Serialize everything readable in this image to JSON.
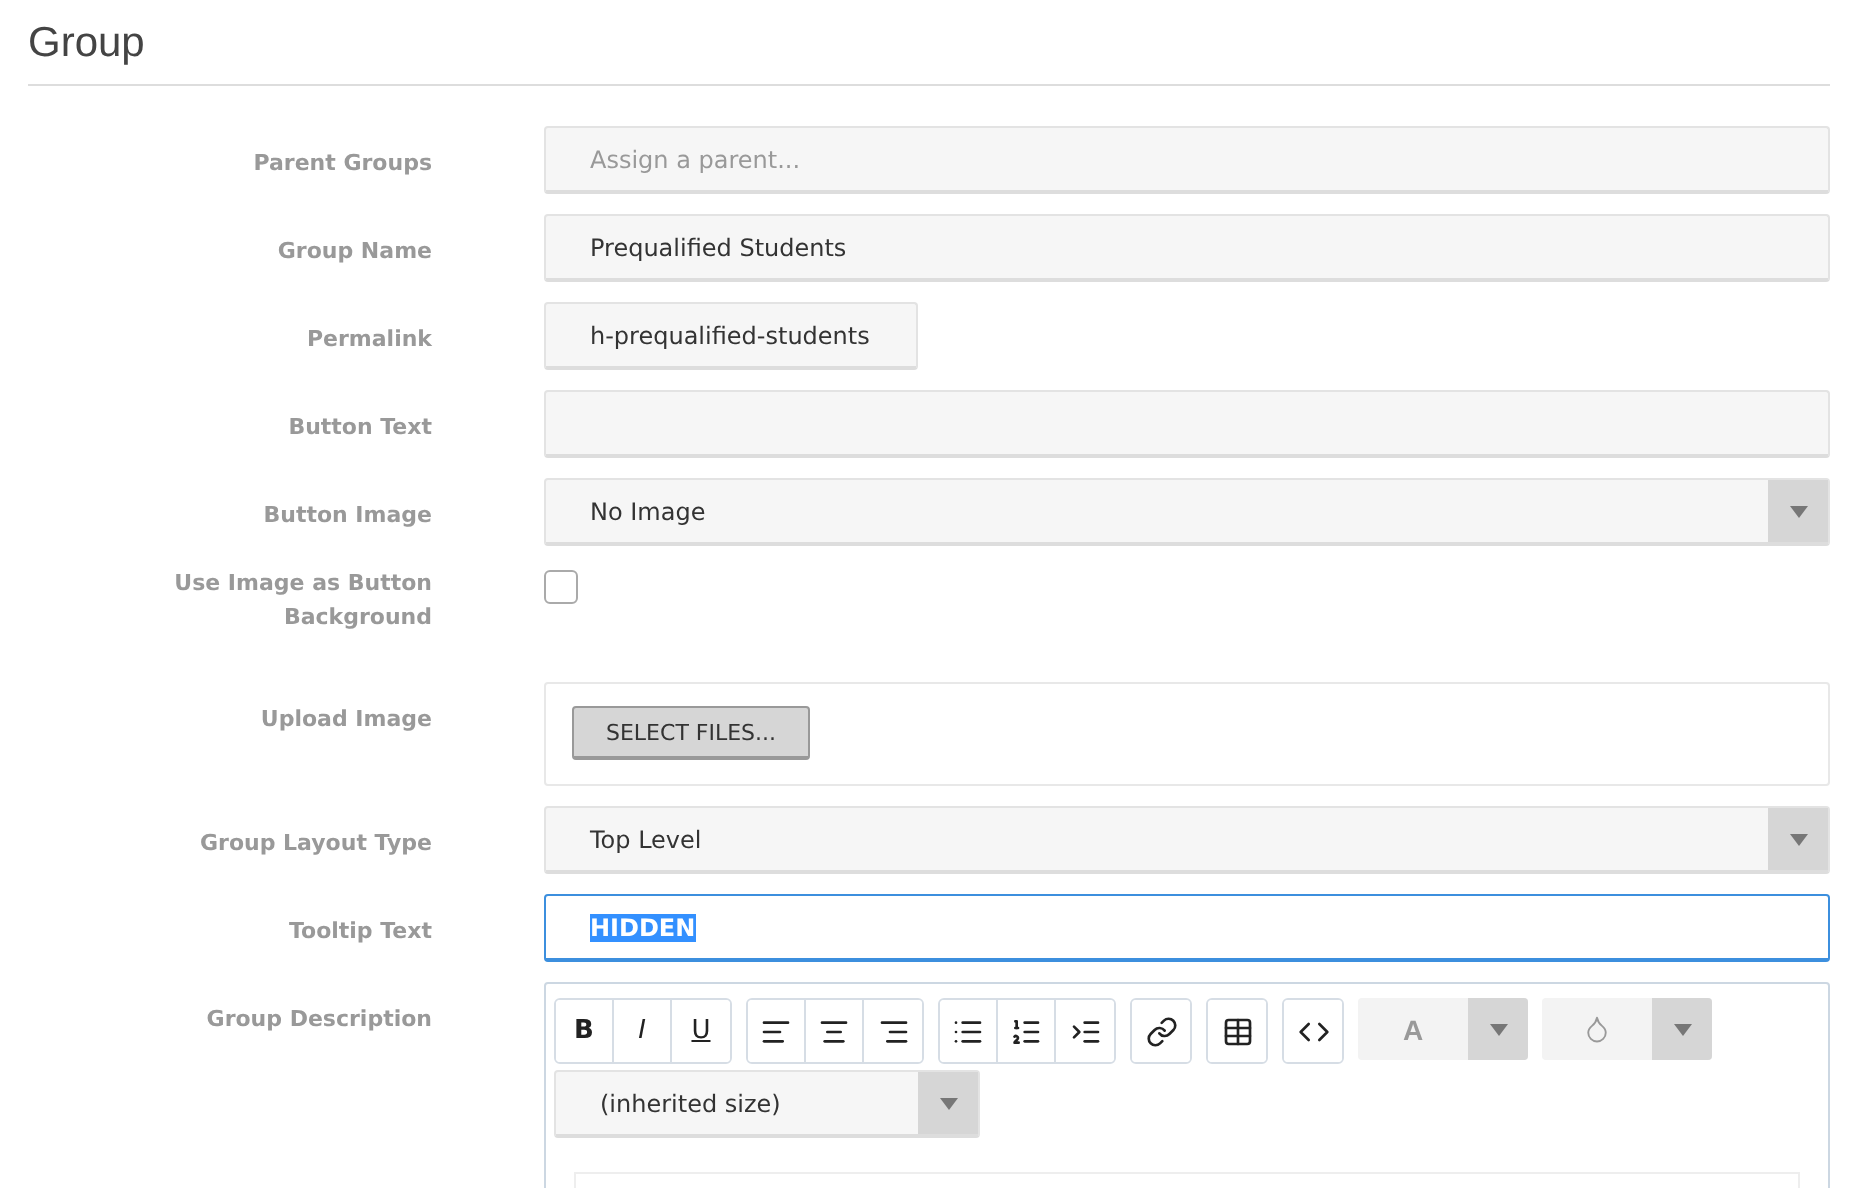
{
  "title": "Group",
  "fields": [
    {
      "kind": "text",
      "label": "Parent Groups",
      "placeholder": "Assign a parent..."
    },
    {
      "kind": "text",
      "label": "Group Name",
      "value": "Prequalified Students"
    },
    {
      "kind": "slug",
      "label": "Permalink",
      "value": "h-prequalified-students"
    },
    {
      "kind": "text",
      "label": "Button Text"
    },
    {
      "kind": "select",
      "label": "Button Image",
      "value": "No Image"
    },
    {
      "kind": "checkbox",
      "label": "Use Image as Button Background",
      "checked": false
    },
    {
      "kind": "upload",
      "label": "Upload Image",
      "button": "SELECT FILES..."
    },
    {
      "kind": "select",
      "label": "Group Layout Type",
      "value": "Top Level"
    },
    {
      "kind": "text",
      "label": "Tooltip Text",
      "value": "HIDDEN",
      "focused": true
    },
    {
      "kind": "editor",
      "label": "Group Description"
    }
  ],
  "editor": {
    "groups": [
      {
        "buttons": [
          {
            "kind": "bold",
            "label": "B"
          },
          {
            "kind": "italic",
            "label": "I"
          },
          {
            "kind": "underline",
            "label": "U"
          }
        ]
      },
      {
        "buttons": [
          {
            "kind": "align-left"
          },
          {
            "kind": "align-center"
          },
          {
            "kind": "align-right"
          }
        ]
      },
      {
        "buttons": [
          {
            "kind": "bullet-list"
          },
          {
            "kind": "numbered-list"
          },
          {
            "kind": "indent"
          }
        ]
      },
      {
        "buttons": [
          {
            "kind": "link"
          }
        ]
      },
      {
        "buttons": [
          {
            "kind": "table"
          }
        ]
      },
      {
        "buttons": [
          {
            "kind": "code"
          }
        ]
      }
    ],
    "pickers": [
      {
        "kind": "font-color",
        "label": "A"
      },
      {
        "kind": "background-color"
      }
    ],
    "size": "(inherited size)"
  }
}
